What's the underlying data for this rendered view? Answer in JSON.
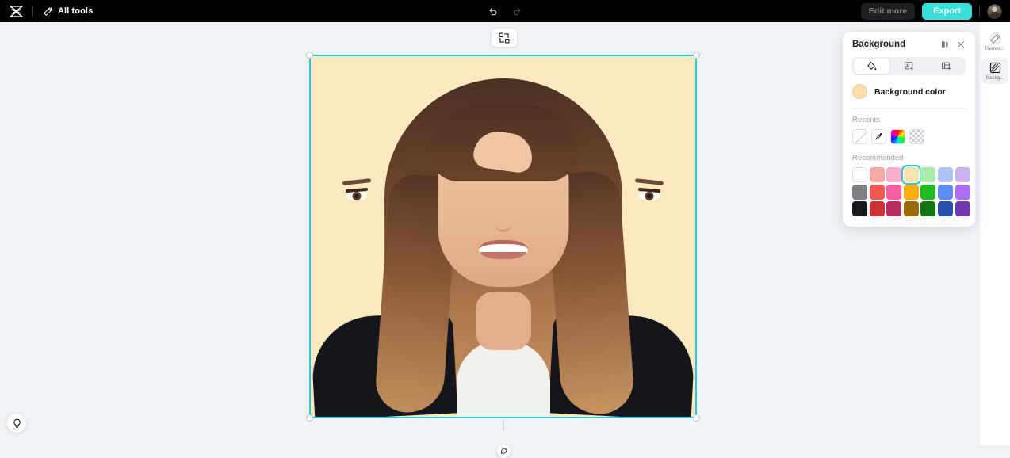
{
  "topbar": {
    "logo_icon": "capcut-logo-icon",
    "all_tools_label": "All tools",
    "all_tools_icon": "magic-wand-icon",
    "undo_icon": "undo-arrow-icon",
    "redo_icon": "redo-arrow-icon",
    "edit_more_label": "Edit more",
    "export_label": "Export",
    "avatar_icon": "user-avatar"
  },
  "canvas": {
    "toolbar_icon": "resize-transform-icon",
    "rotate_icon": "rotate-handle-icon",
    "selection": {
      "border_color": "#25c9e0",
      "handle_color": "#ffffff"
    },
    "background_color": "#fce9bf",
    "subject": "woman-portrait-photo"
  },
  "help": {
    "icon": "lightbulb-icon"
  },
  "right_rail": {
    "items": [
      {
        "label": "Remov...",
        "icon": "magic-eraser-icon",
        "active": false
      },
      {
        "label": "Backg...",
        "icon": "background-square-icon",
        "active": true
      }
    ]
  },
  "background_panel": {
    "title": "Background",
    "compare_icon": "compare-split-icon",
    "close_icon": "close-x-icon",
    "tabs": [
      {
        "icon": "paint-bucket-icon",
        "active": true
      },
      {
        "icon": "add-image-icon",
        "active": false
      },
      {
        "icon": "add-template-icon",
        "active": false
      }
    ],
    "background_color_label": "Background color",
    "background_color_value": "#fadfab",
    "recents_label": "Recents",
    "recents": [
      {
        "icon": "no-color-icon",
        "type": "none"
      },
      {
        "icon": "eyedropper-icon",
        "type": "picker"
      },
      {
        "icon": "color-wheel-icon",
        "type": "wheel"
      },
      {
        "icon": "transparent-checker-icon",
        "type": "transparent"
      }
    ],
    "recommended_label": "Recommended",
    "recommended_colors": [
      "#ffffff",
      "#f5a8a4",
      "#f9aecc",
      "#fce2ad",
      "#abeaad",
      "#aec3f4",
      "#ccb1ef",
      "#7d8086",
      "#ef5a51",
      "#fa5fa3",
      "#fbaf08",
      "#22bb1f",
      "#5e8cf8",
      "#a96ef5",
      "#17191e",
      "#cb3431",
      "#b52d61",
      "#9a6804",
      "#0d7710",
      "#2a4fb0",
      "#7236b3"
    ],
    "selected_color_index": 3
  }
}
